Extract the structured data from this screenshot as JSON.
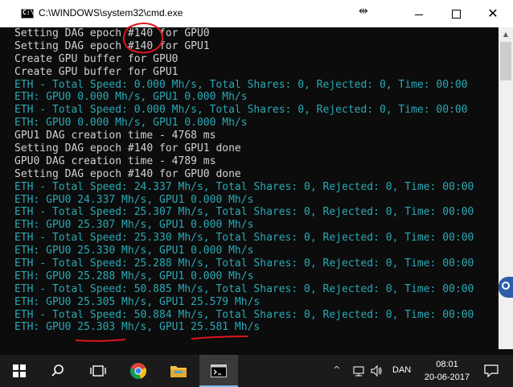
{
  "window": {
    "title": "C:\\WINDOWS\\system32\\cmd.exe",
    "icon_label": "C:\\",
    "close_glyph": "✕",
    "resize_glyph": "⇹"
  },
  "console": {
    "lines": [
      {
        "text": "Setting DAG epoch #140 for GPU0",
        "color": "white"
      },
      {
        "text": "Setting DAG epoch #140 for GPU1",
        "color": "white"
      },
      {
        "text": "Create GPU buffer for GPU0",
        "color": "white"
      },
      {
        "text": "Create GPU buffer for GPU1",
        "color": "white"
      },
      {
        "text": "ETH - Total Speed: 0.000 Mh/s, Total Shares: 0, Rejected: 0, Time: 00:00",
        "color": "teal"
      },
      {
        "text": "ETH: GPU0 0.000 Mh/s, GPU1 0.000 Mh/s",
        "color": "teal"
      },
      {
        "text": "ETH - Total Speed: 0.000 Mh/s, Total Shares: 0, Rejected: 0, Time: 00:00",
        "color": "teal"
      },
      {
        "text": "ETH: GPU0 0.000 Mh/s, GPU1 0.000 Mh/s",
        "color": "teal"
      },
      {
        "text": "GPU1 DAG creation time - 4768 ms",
        "color": "white"
      },
      {
        "text": "Setting DAG epoch #140 for GPU1 done",
        "color": "white"
      },
      {
        "text": "GPU0 DAG creation time - 4789 ms",
        "color": "white"
      },
      {
        "text": "Setting DAG epoch #140 for GPU0 done",
        "color": "white"
      },
      {
        "text": "ETH - Total Speed: 24.337 Mh/s, Total Shares: 0, Rejected: 0, Time: 00:00",
        "color": "teal"
      },
      {
        "text": "ETH: GPU0 24.337 Mh/s, GPU1 0.000 Mh/s",
        "color": "teal"
      },
      {
        "text": "ETH - Total Speed: 25.307 Mh/s, Total Shares: 0, Rejected: 0, Time: 00:00",
        "color": "teal"
      },
      {
        "text": "ETH: GPU0 25.307 Mh/s, GPU1 0.000 Mh/s",
        "color": "teal"
      },
      {
        "text": "ETH - Total Speed: 25.330 Mh/s, Total Shares: 0, Rejected: 0, Time: 00:00",
        "color": "teal"
      },
      {
        "text": "ETH: GPU0 25.330 Mh/s, GPU1 0.000 Mh/s",
        "color": "teal"
      },
      {
        "text": "ETH - Total Speed: 25.288 Mh/s, Total Shares: 0, Rejected: 0, Time: 00:00",
        "color": "teal"
      },
      {
        "text": "ETH: GPU0 25.288 Mh/s, GPU1 0.000 Mh/s",
        "color": "teal"
      },
      {
        "text": "ETH - Total Speed: 50.885 Mh/s, Total Shares: 0, Rejected: 0, Time: 00:00",
        "color": "teal"
      },
      {
        "text": "ETH: GPU0 25.305 Mh/s, GPU1 25.579 Mh/s",
        "color": "teal"
      },
      {
        "text": "ETH - Total Speed: 50.884 Mh/s, Total Shares: 0, Rejected: 0, Time: 00:00",
        "color": "teal"
      },
      {
        "text": "ETH: GPU0 25.303 Mh/s, GPU1 25.581 Mh/s",
        "color": "teal"
      }
    ]
  },
  "taskbar": {
    "language": "DAN",
    "time": "08:01",
    "date": "20-06-2017"
  },
  "colors": {
    "console_white": "#d2d2d2",
    "console_teal": "#2aa9b5",
    "annotation_red": "#e0141e",
    "taskbar_bg": "#1b1b1b"
  }
}
